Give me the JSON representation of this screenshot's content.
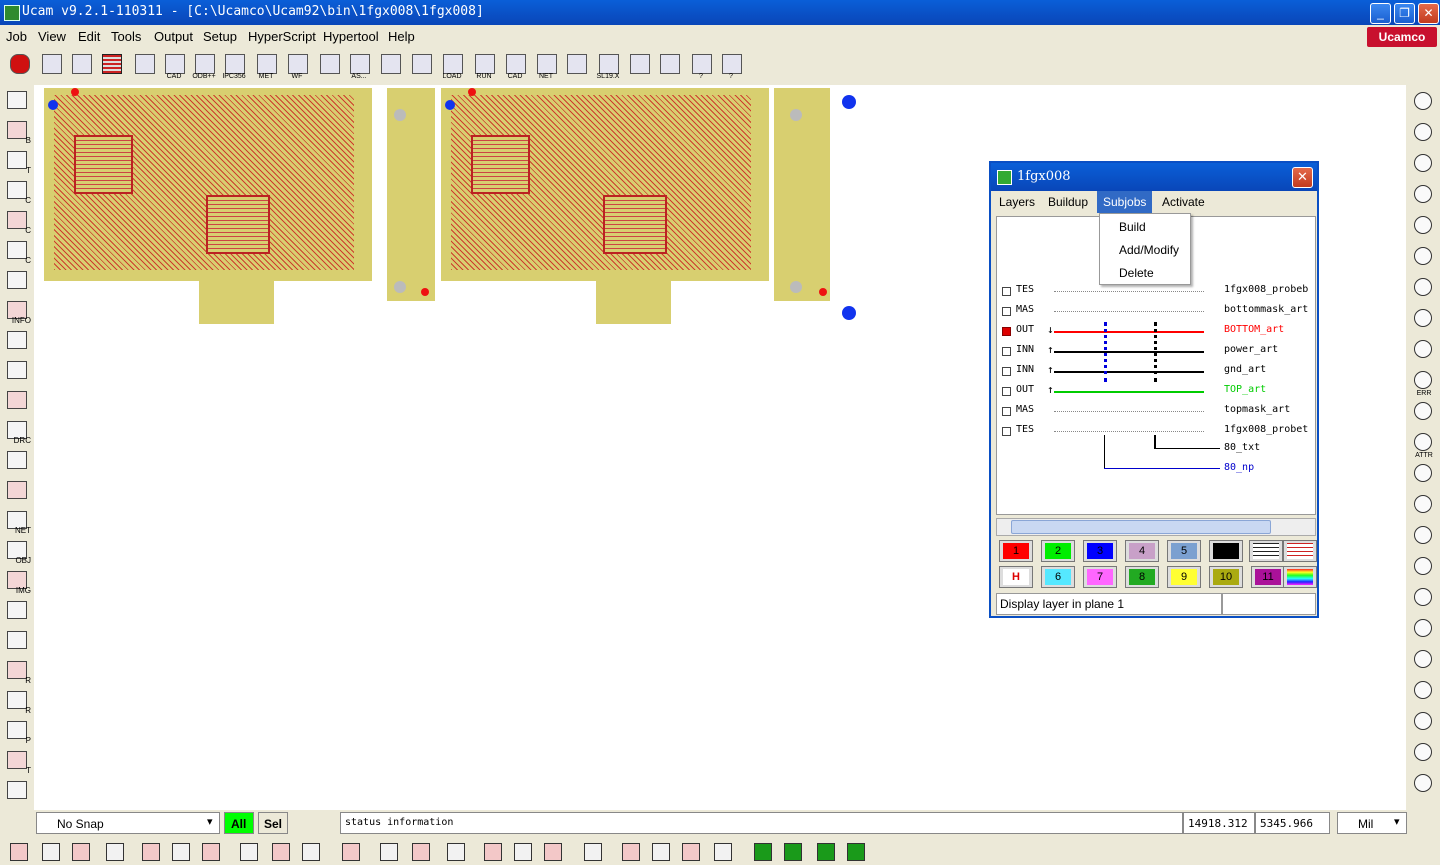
{
  "window": {
    "title": "Ucam v9.2.1-110311 - [C:\\Ucamco\\Ucam92\\bin\\1fgx008\\1fgx008]",
    "brand": "Ucamco"
  },
  "menubar": [
    "Job",
    "View",
    "Edit",
    "Tools",
    "Output",
    "Setup",
    "HyperScript",
    "Hypertool",
    "Help"
  ],
  "toolbar": [
    {
      "icon": "stop-icon",
      "label": ""
    },
    {
      "icon": "new-job-icon",
      "label": ""
    },
    {
      "icon": "open-folder-icon",
      "label": ""
    },
    {
      "icon": "layer-table-icon",
      "label": ""
    },
    {
      "icon": "document-icon",
      "label": ""
    },
    {
      "icon": "cad-import-icon",
      "label": "CAD"
    },
    {
      "icon": "odb-import-icon",
      "label": "ODB++"
    },
    {
      "icon": "ipc356-import-icon",
      "label": "IPC356"
    },
    {
      "icon": "met-import-icon",
      "label": "MET"
    },
    {
      "icon": "wf-import-icon",
      "label": "WF"
    },
    {
      "icon": "save-icon",
      "label": ""
    },
    {
      "icon": "save-as-icon",
      "label": "AS..."
    },
    {
      "icon": "print-icon",
      "label": ""
    },
    {
      "icon": "output-icon",
      "label": ""
    },
    {
      "icon": "load-icon",
      "label": "LOAD"
    },
    {
      "icon": "run-icon",
      "label": "RUN"
    },
    {
      "icon": "cad-export-icon",
      "label": "CAD"
    },
    {
      "icon": "net-export-icon",
      "label": "NET"
    },
    {
      "icon": "analyze-icon",
      "label": ""
    },
    {
      "icon": "sl19-icon",
      "label": "SL19.X"
    },
    {
      "icon": "webcam-icon",
      "label": ""
    },
    {
      "icon": "home-icon",
      "label": ""
    },
    {
      "icon": "help-icon",
      "label": "?"
    },
    {
      "icon": "context-help-icon",
      "label": "?"
    }
  ],
  "left_tools": [
    {
      "icon": "camera-icon",
      "label": ""
    },
    {
      "icon": "chart-b-icon",
      "label": "B"
    },
    {
      "icon": "chart-t-icon",
      "label": "T"
    },
    {
      "icon": "chart-jc-icon",
      "label": "C"
    },
    {
      "icon": "chart-lc-icon",
      "label": "C"
    },
    {
      "icon": "chart-ic-icon",
      "label": "C"
    },
    {
      "icon": "ruler-icon",
      "label": ""
    },
    {
      "icon": "info-icon",
      "label": "INFO"
    },
    {
      "icon": "magnify-icon",
      "label": ""
    },
    {
      "icon": "route-icon",
      "label": ""
    },
    {
      "icon": "shape-icon",
      "label": ""
    },
    {
      "icon": "drc-icon",
      "label": "DRC"
    },
    {
      "icon": "list-icon",
      "label": ""
    },
    {
      "icon": "check-icon",
      "label": ""
    },
    {
      "icon": "net-compare-icon",
      "label": "NET"
    },
    {
      "icon": "obj-compare-icon",
      "label": "OBJ"
    },
    {
      "icon": "img-compare-icon",
      "label": "IMG"
    },
    {
      "icon": "flow-icon",
      "label": ""
    },
    {
      "icon": "list-lines-icon",
      "label": ""
    },
    {
      "icon": "drill-r-icon",
      "label": "R"
    },
    {
      "icon": "drill-r2-icon",
      "label": "R"
    },
    {
      "icon": "drill-p-icon",
      "label": "P"
    },
    {
      "icon": "drill-t-icon",
      "label": "T"
    },
    {
      "icon": "cross-icon",
      "label": ""
    }
  ],
  "right_tools": [
    {
      "icon": "pan-icon",
      "label": ""
    },
    {
      "icon": "zoom-window-icon",
      "label": ""
    },
    {
      "icon": "fit-icon",
      "label": ""
    },
    {
      "icon": "zoom-icon",
      "label": ""
    },
    {
      "icon": "zoom-area-icon",
      "label": ""
    },
    {
      "icon": "zoom-in-icon",
      "label": ""
    },
    {
      "icon": "zoom-out-icon",
      "label": ""
    },
    {
      "icon": "zoom-prev-icon",
      "label": ""
    },
    {
      "icon": "zoom-all-icon",
      "label": ""
    },
    {
      "icon": "binoculars-icon",
      "label": "ERR"
    },
    {
      "icon": "grid-icon",
      "label": ""
    },
    {
      "icon": "attr-icon",
      "label": "ATTR"
    },
    {
      "icon": "magnet-icon",
      "label": ""
    },
    {
      "icon": "magnet-red-icon",
      "label": ""
    },
    {
      "icon": "pointer-icon",
      "label": ""
    },
    {
      "icon": "measure-icon",
      "label": ""
    },
    {
      "icon": "move-icon",
      "label": ""
    },
    {
      "icon": "hammer-icon",
      "label": ""
    },
    {
      "icon": "scissors-icon",
      "label": ""
    },
    {
      "icon": "copy-icon",
      "label": ""
    },
    {
      "icon": "paste-icon",
      "label": ""
    },
    {
      "icon": "undo-icon",
      "label": ""
    },
    {
      "icon": "redo-icon",
      "label": ""
    }
  ],
  "dialog": {
    "title": "1fgx008",
    "menu": [
      "Layers",
      "Buildup",
      "Subjobs",
      "Activate"
    ],
    "active_menu": "Subjobs",
    "submenu": [
      "Build",
      "Add/Modify",
      "Delete"
    ],
    "layers": [
      {
        "type": "TES",
        "arrow": "",
        "name": "1fgx008_probeb",
        "checked": false,
        "line": "dotted",
        "color": "#000000"
      },
      {
        "type": "MAS",
        "arrow": "",
        "name": "bottommask_art",
        "checked": false,
        "line": "dotted",
        "color": "#000000"
      },
      {
        "type": "OUT",
        "arrow": "↓",
        "name": "BOTTOM_art",
        "checked": true,
        "line": "solid",
        "color": "#ff0000"
      },
      {
        "type": "INN",
        "arrow": "↑",
        "name": "power_art",
        "checked": false,
        "line": "solid",
        "color": "#000000"
      },
      {
        "type": "INN",
        "arrow": "↑",
        "name": "gnd_art",
        "checked": false,
        "line": "solid",
        "color": "#000000"
      },
      {
        "type": "OUT",
        "arrow": "↑",
        "name": "TOP_art",
        "checked": false,
        "line": "solid",
        "color": "#00cc00"
      },
      {
        "type": "MAS",
        "arrow": "",
        "name": "topmask_art",
        "checked": false,
        "line": "dotted",
        "color": "#000000"
      },
      {
        "type": "TES",
        "arrow": "",
        "name": "1fgx008_probet",
        "checked": false,
        "line": "dotted",
        "color": "#000000"
      }
    ],
    "drill_layers": [
      {
        "name": "80_txt",
        "color": "#000000"
      },
      {
        "name": "80_np",
        "color": "#0000cc"
      }
    ],
    "color_buttons_row1": [
      {
        "label": "1",
        "color": "#ff0000"
      },
      {
        "label": "2",
        "color": "#00ee00"
      },
      {
        "label": "3",
        "color": "#0000ff"
      },
      {
        "label": "4",
        "color": "#c8a0c8"
      },
      {
        "label": "5",
        "color": "#7ba0d0"
      },
      {
        "label": "",
        "color": "#000000"
      }
    ],
    "color_buttons_row2": [
      {
        "label": "6",
        "color": "#55e8ff"
      },
      {
        "label": "7",
        "color": "#ff66ff"
      },
      {
        "label": "8",
        "color": "#22aa22"
      },
      {
        "label": "9",
        "color": "#ffff33"
      },
      {
        "label": "10",
        "color": "#aaaa11"
      },
      {
        "label": "11",
        "color": "#aa1199"
      }
    ],
    "status": "Display layer in plane 1"
  },
  "statusbar": {
    "snap": "No Snap",
    "all_label": "All",
    "sel_label": "Sel",
    "status_info": "status information",
    "x_coord": "14918.312",
    "y_coord": "5345.966",
    "units": "Mil"
  },
  "colors": {
    "board": "#d8cf70",
    "trace": "#c22222",
    "accent": "#0a4fc4"
  }
}
